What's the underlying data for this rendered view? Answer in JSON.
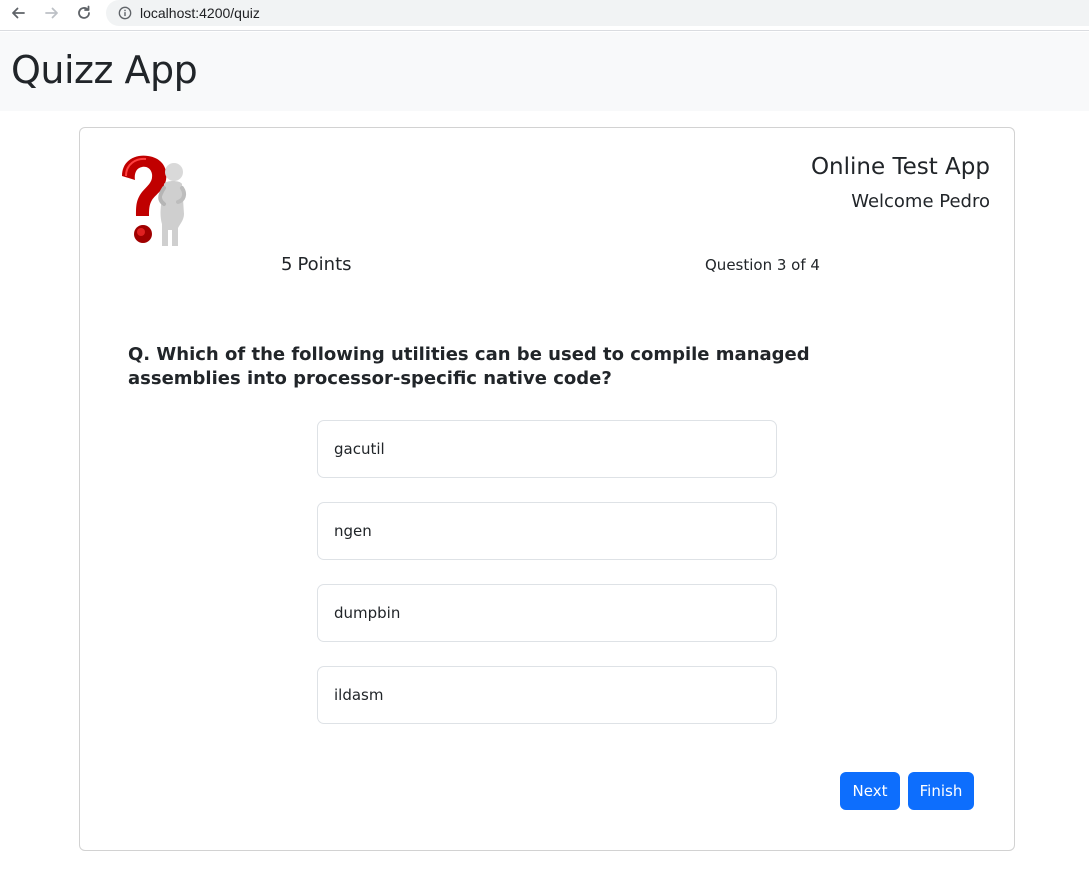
{
  "browser": {
    "url": "localhost:4200/quiz",
    "icons": [
      "back-arrow-icon",
      "forward-arrow-icon",
      "reload-icon",
      "info-icon"
    ]
  },
  "navbar": {
    "brand": "Quizz App"
  },
  "card": {
    "logo_icon": "question-mark-figure-icon",
    "app_title": "Online Test App",
    "welcome": "Welcome Pedro",
    "points_value": "5",
    "points_label": "Points",
    "progress": "Question 3 of 4",
    "question": "Q. Which of the following utilities can be used to compile managed assemblies into processor-specific native code?",
    "options": [
      {
        "label": "gacutil"
      },
      {
        "label": "ngen"
      },
      {
        "label": "dumpbin"
      },
      {
        "label": "ildasm"
      }
    ],
    "next_label": "Next",
    "finish_label": "Finish"
  },
  "colors": {
    "primary": "#0d6efd",
    "navbar_bg": "#f8f9fa",
    "url_bar_bg": "#f1f3f4",
    "logo_red": "#c00000"
  }
}
